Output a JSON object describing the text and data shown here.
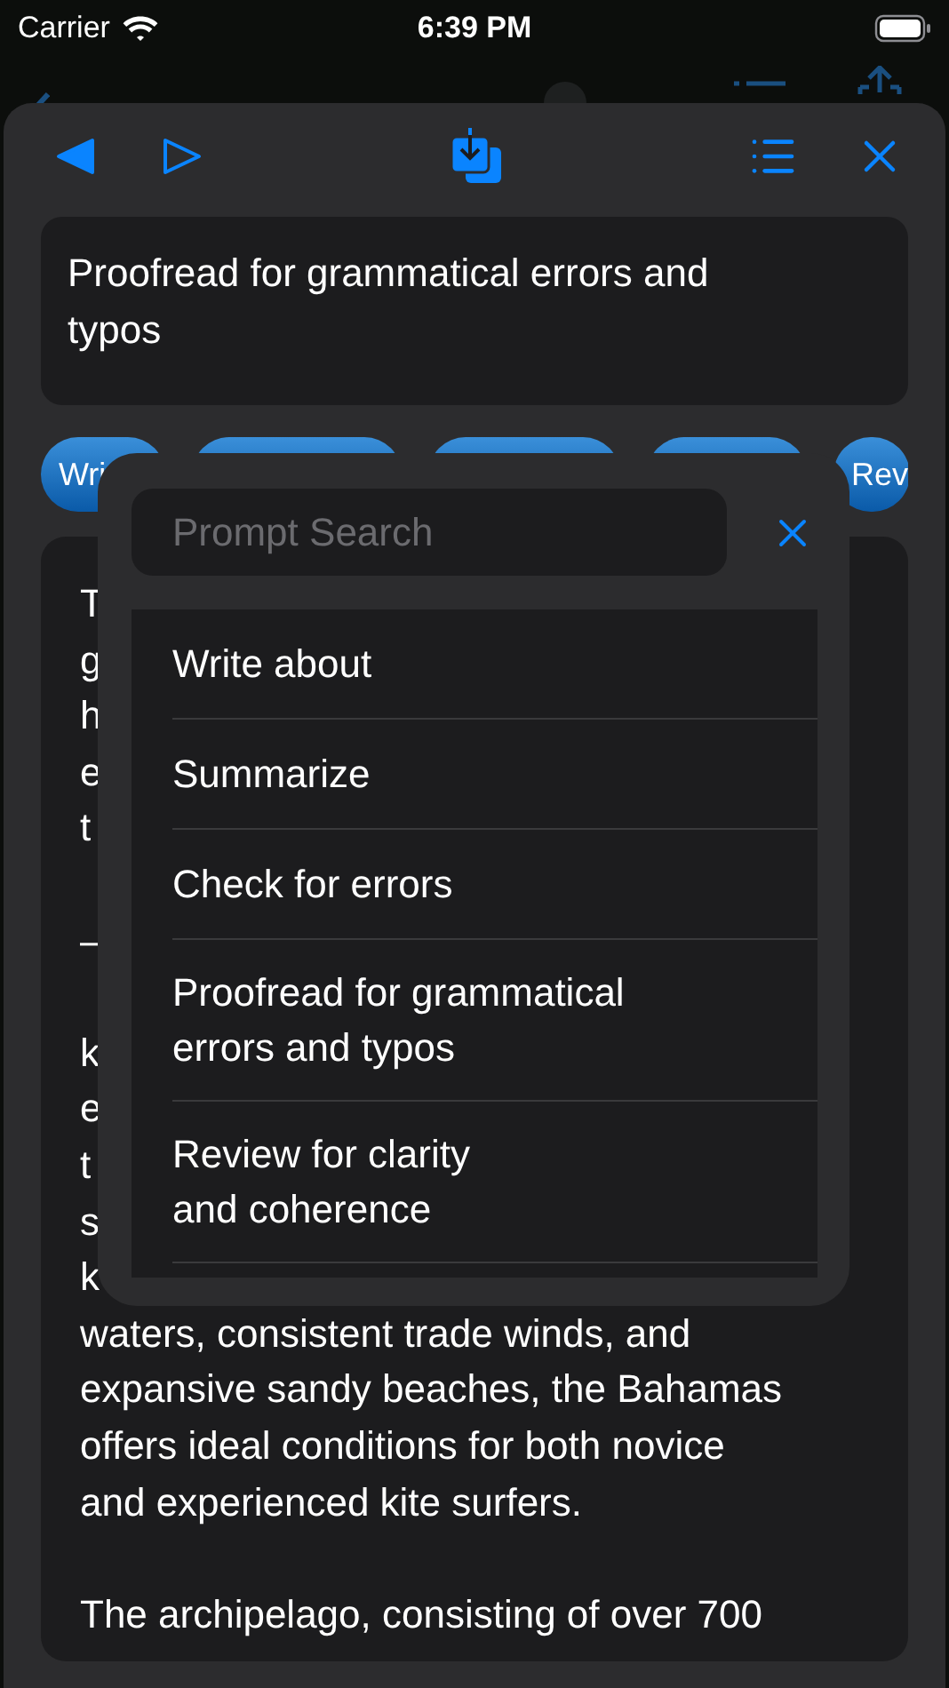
{
  "status_bar": {
    "carrier": "Carrier",
    "time": "6:39 PM"
  },
  "prompt": {
    "text": "Proofread for grammatical errors and typos"
  },
  "chips": [
    {
      "kind": "labeled",
      "label": "Wri"
    },
    {
      "kind": "covered"
    },
    {
      "kind": "covered"
    },
    {
      "kind": "covered"
    },
    {
      "kind": "labeled",
      "label": "Rev"
    }
  ],
  "document": {
    "lines": [
      {
        "kind": "text",
        "text": "T"
      },
      {
        "kind": "text",
        "text": "g"
      },
      {
        "kind": "text",
        "text": "h"
      },
      {
        "kind": "text",
        "text": "e"
      },
      {
        "kind": "text",
        "text": "t"
      },
      {
        "kind": "blank"
      },
      {
        "kind": "text",
        "text": "–"
      },
      {
        "kind": "blank"
      },
      {
        "kind": "text",
        "text": "k"
      },
      {
        "kind": "text",
        "text": "e"
      },
      {
        "kind": "text",
        "text": "t"
      },
      {
        "kind": "text",
        "text": "s"
      },
      {
        "kind": "text",
        "text": "k"
      },
      {
        "kind": "text",
        "text": "waters, consistent trade winds, and"
      },
      {
        "kind": "text",
        "text": "expansive sandy beaches, the Bahamas"
      },
      {
        "kind": "text",
        "text": "offers ideal conditions for both novice"
      },
      {
        "kind": "text",
        "text": "and experienced kite surfers."
      },
      {
        "kind": "blank"
      },
      {
        "kind": "text",
        "text": "The archipelago, consisting of over 700"
      }
    ]
  },
  "prompt_picker": {
    "search": {
      "placeholder": "Prompt Search"
    },
    "items": [
      {
        "label": "Write about"
      },
      {
        "label": "Summarize"
      },
      {
        "label": "Check for errors"
      },
      {
        "label": "Proofread for grammatical\nerrors and typos"
      },
      {
        "label": "Review for clarity\nand coherence"
      }
    ]
  }
}
